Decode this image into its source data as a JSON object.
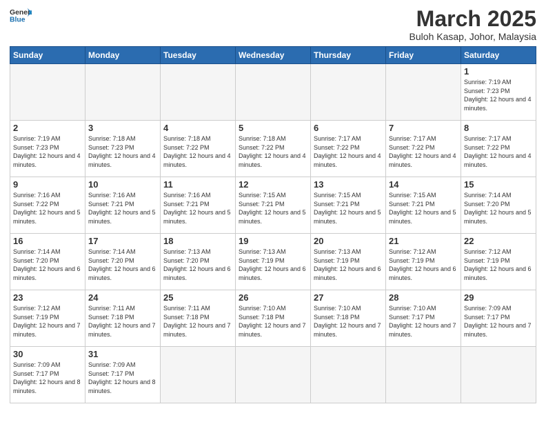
{
  "header": {
    "logo_general": "General",
    "logo_blue": "Blue",
    "month_year": "March 2025",
    "location": "Buloh Kasap, Johor, Malaysia"
  },
  "weekdays": [
    "Sunday",
    "Monday",
    "Tuesday",
    "Wednesday",
    "Thursday",
    "Friday",
    "Saturday"
  ],
  "days": {
    "1": {
      "sunrise": "7:19 AM",
      "sunset": "7:23 PM",
      "daylight": "12 hours and 4 minutes."
    },
    "2": {
      "sunrise": "7:19 AM",
      "sunset": "7:23 PM",
      "daylight": "12 hours and 4 minutes."
    },
    "3": {
      "sunrise": "7:18 AM",
      "sunset": "7:23 PM",
      "daylight": "12 hours and 4 minutes."
    },
    "4": {
      "sunrise": "7:18 AM",
      "sunset": "7:22 PM",
      "daylight": "12 hours and 4 minutes."
    },
    "5": {
      "sunrise": "7:18 AM",
      "sunset": "7:22 PM",
      "daylight": "12 hours and 4 minutes."
    },
    "6": {
      "sunrise": "7:17 AM",
      "sunset": "7:22 PM",
      "daylight": "12 hours and 4 minutes."
    },
    "7": {
      "sunrise": "7:17 AM",
      "sunset": "7:22 PM",
      "daylight": "12 hours and 4 minutes."
    },
    "8": {
      "sunrise": "7:17 AM",
      "sunset": "7:22 PM",
      "daylight": "12 hours and 4 minutes."
    },
    "9": {
      "sunrise": "7:16 AM",
      "sunset": "7:22 PM",
      "daylight": "12 hours and 5 minutes."
    },
    "10": {
      "sunrise": "7:16 AM",
      "sunset": "7:21 PM",
      "daylight": "12 hours and 5 minutes."
    },
    "11": {
      "sunrise": "7:16 AM",
      "sunset": "7:21 PM",
      "daylight": "12 hours and 5 minutes."
    },
    "12": {
      "sunrise": "7:15 AM",
      "sunset": "7:21 PM",
      "daylight": "12 hours and 5 minutes."
    },
    "13": {
      "sunrise": "7:15 AM",
      "sunset": "7:21 PM",
      "daylight": "12 hours and 5 minutes."
    },
    "14": {
      "sunrise": "7:15 AM",
      "sunset": "7:21 PM",
      "daylight": "12 hours and 5 minutes."
    },
    "15": {
      "sunrise": "7:14 AM",
      "sunset": "7:20 PM",
      "daylight": "12 hours and 5 minutes."
    },
    "16": {
      "sunrise": "7:14 AM",
      "sunset": "7:20 PM",
      "daylight": "12 hours and 6 minutes."
    },
    "17": {
      "sunrise": "7:14 AM",
      "sunset": "7:20 PM",
      "daylight": "12 hours and 6 minutes."
    },
    "18": {
      "sunrise": "7:13 AM",
      "sunset": "7:20 PM",
      "daylight": "12 hours and 6 minutes."
    },
    "19": {
      "sunrise": "7:13 AM",
      "sunset": "7:19 PM",
      "daylight": "12 hours and 6 minutes."
    },
    "20": {
      "sunrise": "7:13 AM",
      "sunset": "7:19 PM",
      "daylight": "12 hours and 6 minutes."
    },
    "21": {
      "sunrise": "7:12 AM",
      "sunset": "7:19 PM",
      "daylight": "12 hours and 6 minutes."
    },
    "22": {
      "sunrise": "7:12 AM",
      "sunset": "7:19 PM",
      "daylight": "12 hours and 6 minutes."
    },
    "23": {
      "sunrise": "7:12 AM",
      "sunset": "7:19 PM",
      "daylight": "12 hours and 7 minutes."
    },
    "24": {
      "sunrise": "7:11 AM",
      "sunset": "7:18 PM",
      "daylight": "12 hours and 7 minutes."
    },
    "25": {
      "sunrise": "7:11 AM",
      "sunset": "7:18 PM",
      "daylight": "12 hours and 7 minutes."
    },
    "26": {
      "sunrise": "7:10 AM",
      "sunset": "7:18 PM",
      "daylight": "12 hours and 7 minutes."
    },
    "27": {
      "sunrise": "7:10 AM",
      "sunset": "7:18 PM",
      "daylight": "12 hours and 7 minutes."
    },
    "28": {
      "sunrise": "7:10 AM",
      "sunset": "7:17 PM",
      "daylight": "12 hours and 7 minutes."
    },
    "29": {
      "sunrise": "7:09 AM",
      "sunset": "7:17 PM",
      "daylight": "12 hours and 7 minutes."
    },
    "30": {
      "sunrise": "7:09 AM",
      "sunset": "7:17 PM",
      "daylight": "12 hours and 8 minutes."
    },
    "31": {
      "sunrise": "7:09 AM",
      "sunset": "7:17 PM",
      "daylight": "12 hours and 8 minutes."
    }
  }
}
